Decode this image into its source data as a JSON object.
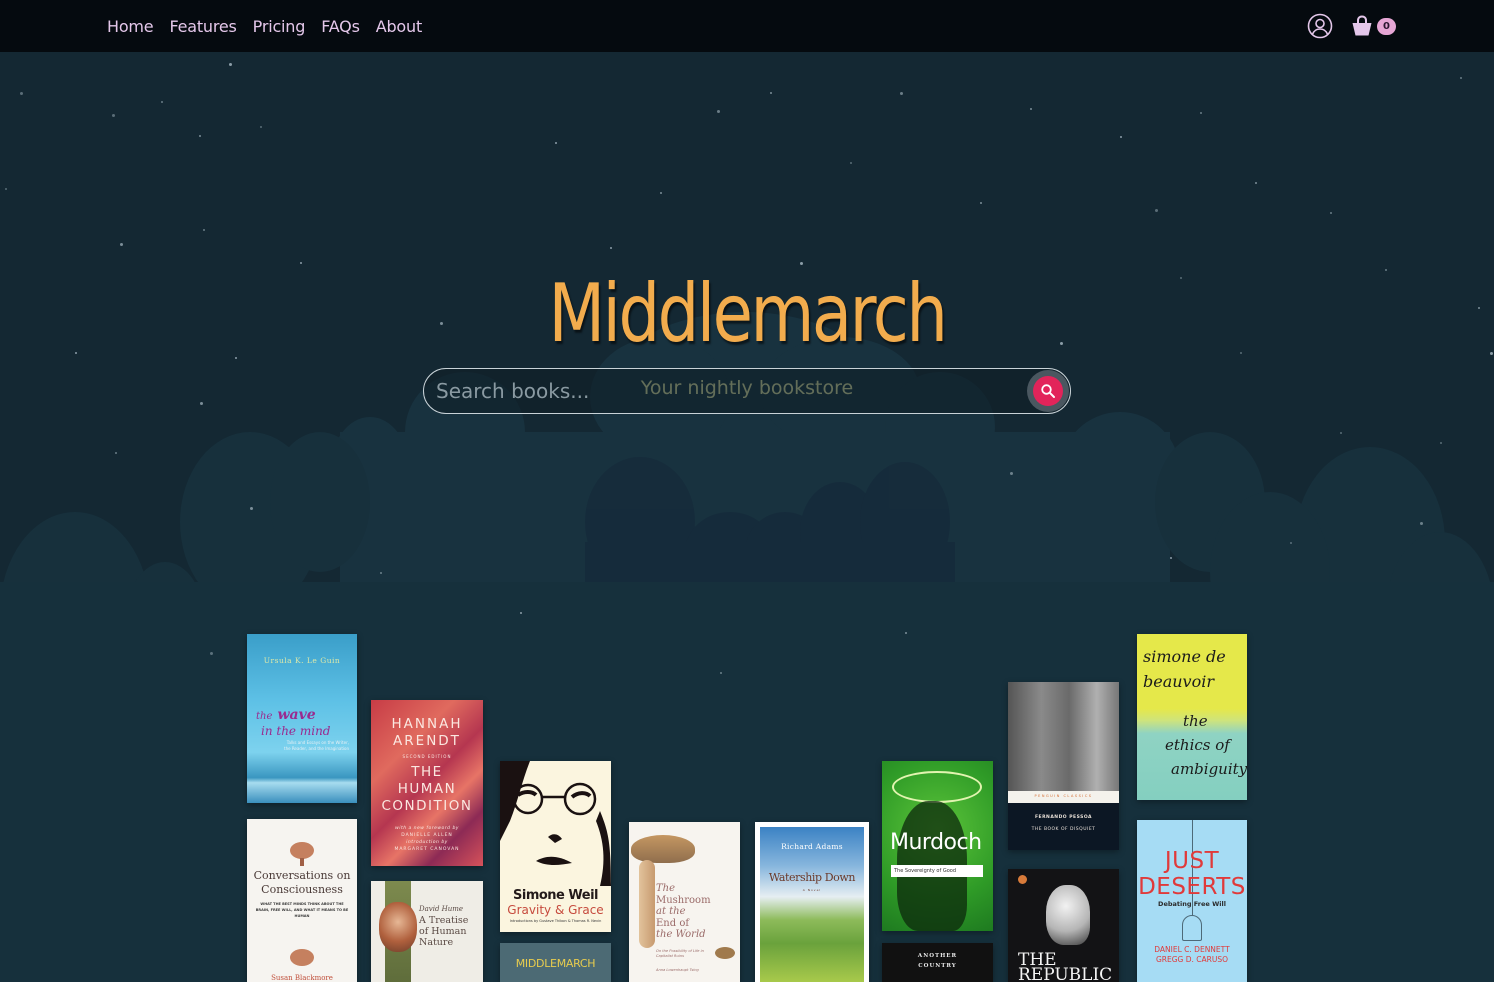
{
  "nav": {
    "links": [
      "Home",
      "Features",
      "Pricing",
      "FAQs",
      "About"
    ],
    "account_icon": "user-circle-icon",
    "cart_icon": "shopping-basket-icon",
    "cart_count": "0"
  },
  "hero": {
    "title": "Middlemarch",
    "tagline": "Your nightly bookstore",
    "search": {
      "placeholder": "Search books...",
      "value": "",
      "button_icon": "search-icon"
    }
  },
  "colors": {
    "background": "#142833",
    "nav_background": "#050a0f",
    "nav_text": "#e4c7ea",
    "title": "#f2ac4d",
    "tagline": "#e2e6a5",
    "search_button": "#e2245a",
    "cart_badge": "#e6a6d5"
  },
  "books": [
    {
      "id": "wave",
      "author": "Ursula K. Le Guin",
      "title_lines": [
        "the",
        "wave",
        "in the mind"
      ],
      "subtitle": "Talks and Essays on the Writer, the Reader, and the Imagination"
    },
    {
      "id": "conversations",
      "author": "Susan Blackmore",
      "title_lines": [
        "Conversations on",
        "Consciousness"
      ],
      "subtitle": "What the best minds think about the brain, free will, and what it means to be human"
    },
    {
      "id": "human-condition",
      "author": "Hannah Arendt",
      "title_lines": [
        "THE",
        "HUMAN",
        "CONDITION"
      ],
      "edition": "Second Edition",
      "credits": [
        "with a new foreword by",
        "Danielle Allen",
        "introduction by",
        "Margaret Canovan"
      ]
    },
    {
      "id": "treatise",
      "author": "David Hume",
      "title_lines": [
        "A Treatise",
        "of Human",
        "Nature"
      ]
    },
    {
      "id": "gravity-grace",
      "author": "Simone Weil",
      "title_lines": [
        "Gravity & Grace"
      ],
      "subtitle": "Introductions by Gustave Thibon & Thomas R. Nevin"
    },
    {
      "id": "middlemarch",
      "author": "",
      "title_lines": [
        "MIDDLEMARCH"
      ]
    },
    {
      "id": "mushroom",
      "author": "Anna Lowenhaupt Tsing",
      "title_lines": [
        "The",
        "Mushroom",
        "at the",
        "End of",
        "the World"
      ],
      "subtitle": "On the Possibility of Life in Capitalist Ruins"
    },
    {
      "id": "watership",
      "author": "Richard Adams",
      "title_lines": [
        "Watership Down"
      ],
      "subtitle": "A Novel"
    },
    {
      "id": "sovereignty",
      "author": "Murdoch",
      "title_lines": [
        "The Sovereignty of Good"
      ]
    },
    {
      "id": "another-country",
      "author": "",
      "title_lines": [
        "ANOTHER",
        "COUNTRY"
      ]
    },
    {
      "id": "disquiet",
      "author": "Fernando Pessoa",
      "title_lines": [
        "The Book of Disquiet"
      ],
      "series": "Penguin Classics"
    },
    {
      "id": "republic",
      "author": "",
      "title_lines": [
        "THE",
        "REPUBLIC"
      ]
    },
    {
      "id": "ambiguity",
      "author": "simone de beauvoir",
      "title_lines": [
        "the",
        "ethics of",
        "ambiguity"
      ]
    },
    {
      "id": "just-deserts",
      "author": "Daniel C. Dennett / Gregg D. Caruso",
      "authors": [
        "DANIEL C. DENNETT",
        "GREGG D. CARUSO"
      ],
      "title_lines": [
        "JUST",
        "DESERTS"
      ],
      "subtitle": "Debating Free Will"
    }
  ]
}
